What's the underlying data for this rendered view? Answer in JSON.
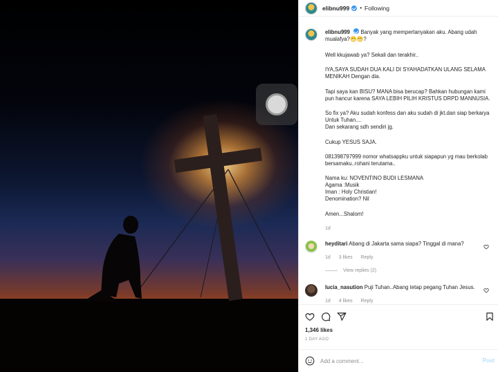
{
  "post": {
    "username": "elibnu999",
    "follow_state": "Following",
    "separator": "•"
  },
  "caption": {
    "username": "elibnu999",
    "first_line": "Banyak yang mempertanyakan aku. Abang udah mualafya?",
    "first_line_emoji": "😬😬?",
    "paragraphs": [
      "Well kkujawab ya? Sekali dan terakhir..",
      "IYA,SAYA SUDAH DUA KALI DI SYAHADATKAN ULANG SELAMA MENIKAH Dengan dia.",
      "Tapi saya kan BISU? MANA bisa berucap? Bahkan hubungan kami pun hancur karena SAYA LEBIH PILIH KRISTUS DRPD MANNUSIA.",
      "So fix ya? Aku sudah konfess dan aku sudah di jkt.dan siap berkarya Untuk Tuhan....\nDan sekarang sdh sendiri jg.",
      "Cukup YESUS SAJA.",
      "081398797999 nomor whatsappku untuk siapapun yg mau berkolab bersamaku..rohani terutama..",
      "Nama ku: NOVENTINO BUDI LESMANA\nAgama :Musik\nIman : Holy Christian!\nDenomination? Nil",
      "Amen...Shalom!"
    ],
    "time": "1d"
  },
  "comments": [
    {
      "username": "heyditari",
      "text": "Abang di Jakarta sama siapa? Tinggal di mana?",
      "time": "1d",
      "likes": "3 likes",
      "reply": "Reply"
    },
    {
      "username": "lucia_nasution",
      "text": "Puji Tuhan..Abang tetap pegang Tuhan Jesus.",
      "time": "1d",
      "likes": "4 likes",
      "reply": "Reply"
    }
  ],
  "view_replies": "View replies (2)",
  "likes_count": "1,346 likes",
  "post_date": "1 DAY AGO",
  "add_comment": {
    "placeholder": "Add a comment...",
    "post_label": "Post"
  },
  "icons": {
    "like": "heart-icon",
    "comment": "comment-icon",
    "share": "share-icon",
    "save": "bookmark-icon",
    "emoji": "emoji-icon",
    "video": "play-indicator-icon"
  },
  "colors": {
    "link_blue": "#3897f0",
    "post_disabled": "#b2dffc",
    "muted": "#8e8e8e"
  }
}
